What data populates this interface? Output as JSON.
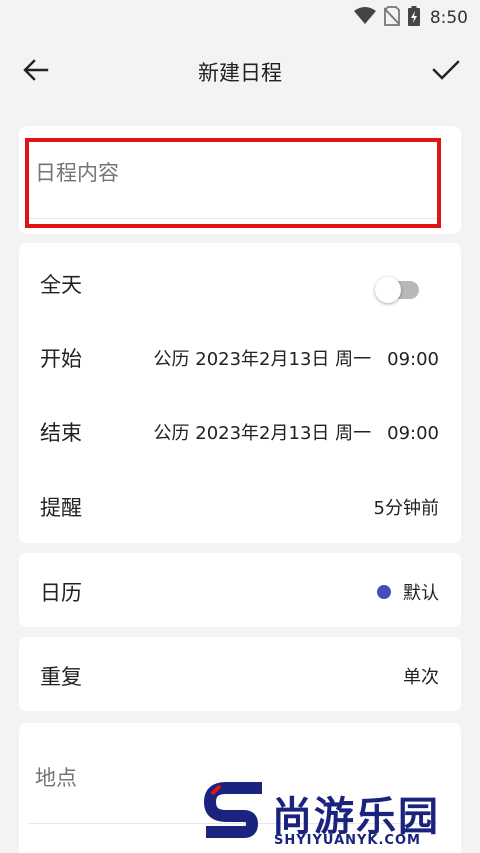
{
  "status_bar": {
    "time": "8:50",
    "icons": [
      "wifi-icon",
      "no-sim-icon",
      "battery-charging-icon"
    ]
  },
  "toolbar": {
    "title": "新建日程",
    "back_icon": "arrow-left-icon",
    "confirm_icon": "check-icon"
  },
  "content": {
    "placeholder": "日程内容",
    "highlight_color": "#e01414"
  },
  "time_section": {
    "all_day": {
      "label": "全天",
      "enabled": false
    },
    "start": {
      "label": "开始",
      "date": "公历 2023年2月13日 周一",
      "time": "09:00"
    },
    "end": {
      "label": "结束",
      "date": "公历 2023年2月13日 周一",
      "time": "09:00"
    },
    "reminder": {
      "label": "提醒",
      "value": "5分钟前"
    }
  },
  "calendar": {
    "label": "日历",
    "value": "默认",
    "color": "#3f51b5"
  },
  "repeat": {
    "label": "重复",
    "value": "单次"
  },
  "location": {
    "placeholder": "地点"
  },
  "watermark": {
    "brand": "尚游乐园",
    "domain": "SHYIYUANYK.COM"
  }
}
